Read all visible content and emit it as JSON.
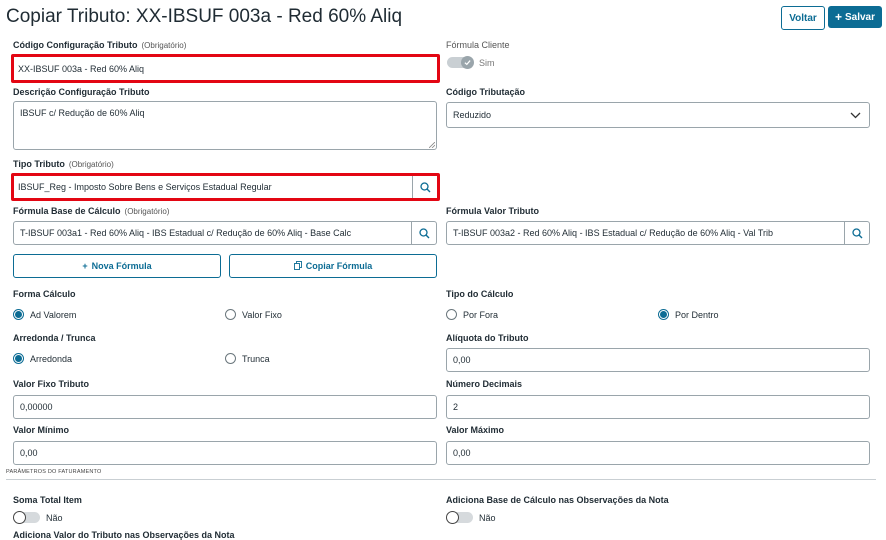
{
  "header": {
    "title": "Copiar Tributo: XX-IBSUF 003a - Red 60% Aliq",
    "voltar_label": "Voltar",
    "salvar_label": "Salvar",
    "salvar_icon": "plus-icon"
  },
  "codigo_config": {
    "label": "Código Configuração Tributo",
    "hint": "(Obrigatório)",
    "value": "XX-IBSUF 003a - Red 60% Aliq"
  },
  "formula_cliente": {
    "label": "Fórmula Cliente",
    "state": "Sim"
  },
  "descricao": {
    "label": "Descrição Configuração Tributo",
    "value": "IBSUF c/ Redução de 60% Aliq"
  },
  "codigo_tributacao": {
    "label": "Código Tributação",
    "value": "Reduzido"
  },
  "tipo_tributo": {
    "label": "Tipo Tributo",
    "hint": "(Obrigatório)",
    "value": "IBSUF_Reg - Imposto Sobre Bens e Serviços Estadual Regular"
  },
  "formula_base": {
    "label": "Fórmula Base de Cálculo",
    "hint": "(Obrigatório)",
    "value": "T-IBSUF 003a1 - Red 60% Aliq - IBS Estadual c/ Redução de 60% Aliq - Base Calc"
  },
  "formula_valor": {
    "label": "Fórmula Valor Tributo",
    "value": "T-IBSUF 003a2 - Red 60% Aliq - IBS Estadual c/ Redução de 60% Aliq - Val Trib"
  },
  "buttons": {
    "nova_formula": "Nova Fórmula",
    "copiar_formula": "Copiar Fórmula"
  },
  "forma_calculo": {
    "label": "Forma Cálculo",
    "options": [
      "Ad Valorem",
      "Valor Fixo"
    ],
    "selected": "Ad Valorem"
  },
  "tipo_calculo": {
    "label": "Tipo do Cálculo",
    "options": [
      "Por Fora",
      "Por Dentro"
    ],
    "selected": "Por Dentro"
  },
  "arredonda_trunca": {
    "label": "Arredonda / Trunca",
    "options": [
      "Arredonda",
      "Trunca"
    ],
    "selected": "Arredonda"
  },
  "aliquota": {
    "label": "Alíquota do Tributo",
    "value": "0,00"
  },
  "valor_fixo": {
    "label": "Valor Fixo Tributo",
    "value": "0,00000"
  },
  "numero_decimais": {
    "label": "Número Decimais",
    "value": "2"
  },
  "valor_minimo": {
    "label": "Valor Mínimo",
    "value": "0,00"
  },
  "valor_maximo": {
    "label": "Valor Máximo",
    "value": "0,00"
  },
  "section_faturamento": "PARÂMETROS DO FATURAMENTO",
  "soma_total_item": {
    "label": "Soma Total Item",
    "state": "Não"
  },
  "adiciona_base_obs": {
    "label": "Adiciona Base de Cálculo nas Observações da Nota",
    "state": "Não"
  },
  "adiciona_valor_obs": {
    "label": "Adiciona Valor do Tributo nas Observações da Nota"
  },
  "colors": {
    "accent": "#0c6c94",
    "highlight": "#e30613",
    "border": "#9aa5ab"
  }
}
